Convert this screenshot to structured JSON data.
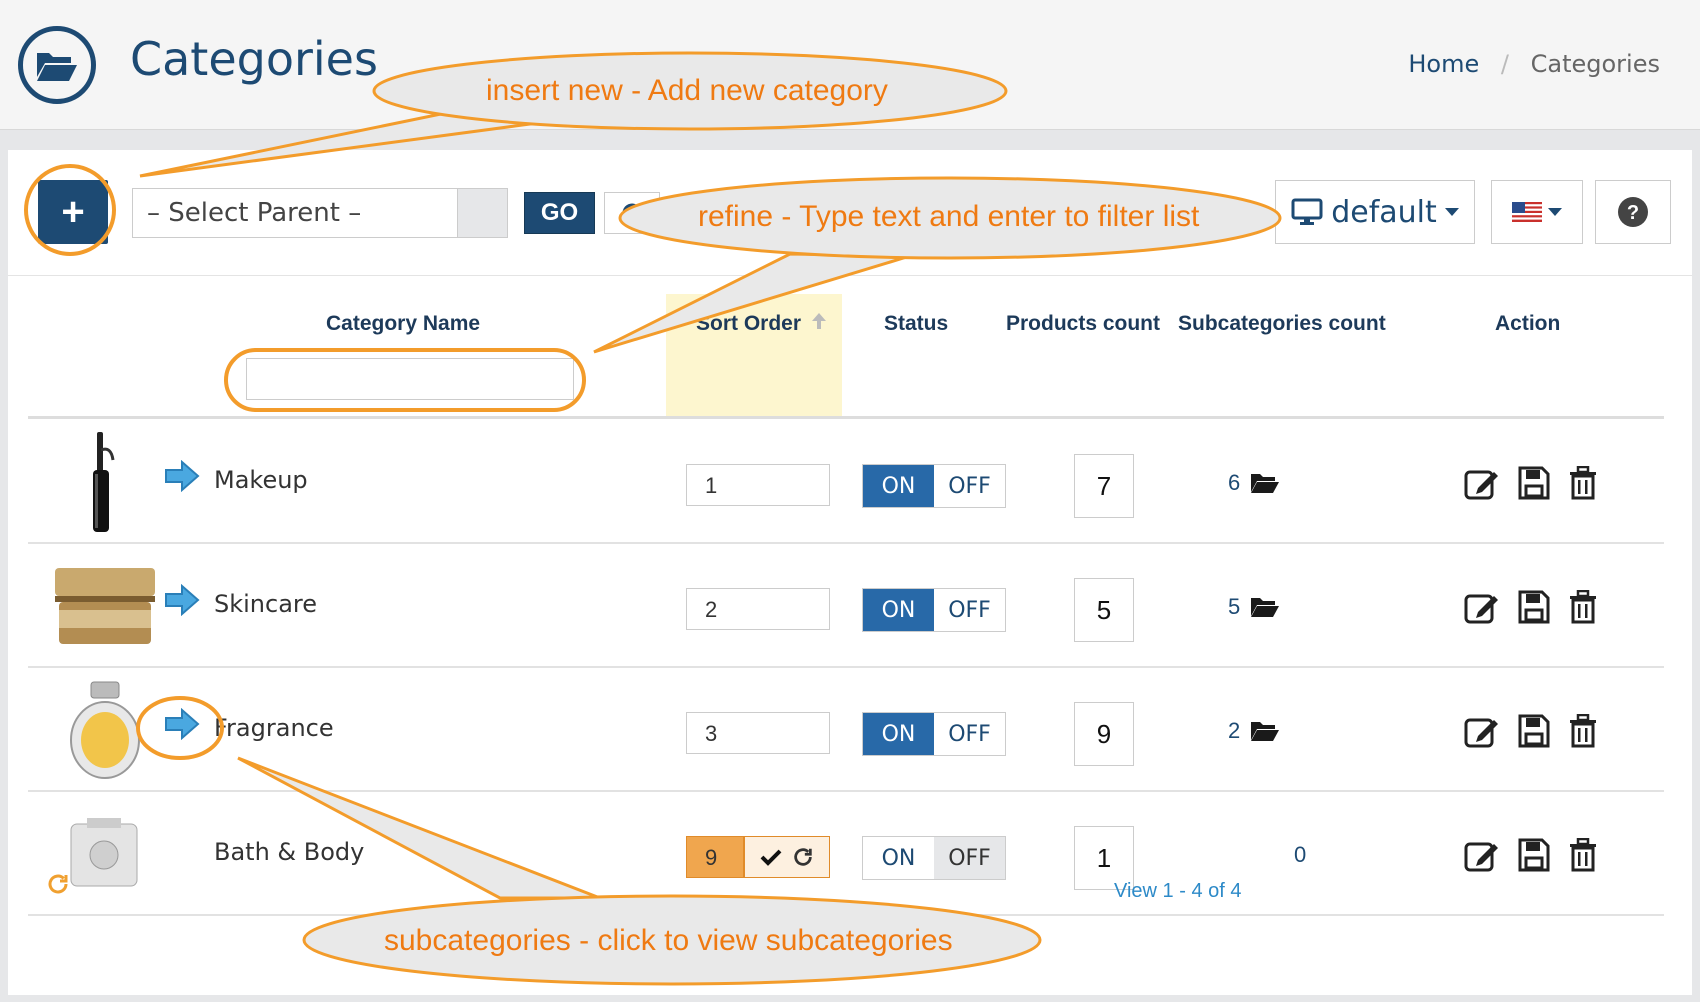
{
  "header": {
    "title": "Categories",
    "breadcrumb": {
      "home": "Home",
      "separator": "/",
      "current": "Categories"
    }
  },
  "toolbar": {
    "add_label": "+",
    "select_parent": "– Select Parent –",
    "go_label": "GO",
    "layout_label": "default"
  },
  "table": {
    "columns": {
      "name": "Category Name",
      "sort": "Sort Order",
      "status": "Status",
      "products": "Products count",
      "subcategories": "Subcategories count",
      "action": "Action"
    },
    "status_on": "ON",
    "status_off": "OFF",
    "rows": [
      {
        "name": "Makeup",
        "sort": "1",
        "status": "on",
        "products": "7",
        "subcategories": "6",
        "has_sub": true
      },
      {
        "name": "Skincare",
        "sort": "2",
        "status": "on",
        "products": "5",
        "subcategories": "5",
        "has_sub": true
      },
      {
        "name": "Fragrance",
        "sort": "3",
        "status": "on",
        "products": "9",
        "subcategories": "2",
        "has_sub": true
      },
      {
        "name": "Bath & Body",
        "sort": "9",
        "status": "off",
        "products": "1",
        "subcategories": "0",
        "has_sub": false
      }
    ]
  },
  "pager": "View 1 - 4 of 4",
  "annotations": {
    "insert": "insert new - Add new category",
    "refine": "refine - Type text and enter to filter list",
    "subcategories": "subcategories - click to view subcategories"
  },
  "colors": {
    "primary": "#1d4a73",
    "toggle_on": "#2869a8",
    "annotation_orange": "#f39c2b",
    "annotation_text": "#ef7a12",
    "bubble_fill": "#e9e9e9"
  }
}
